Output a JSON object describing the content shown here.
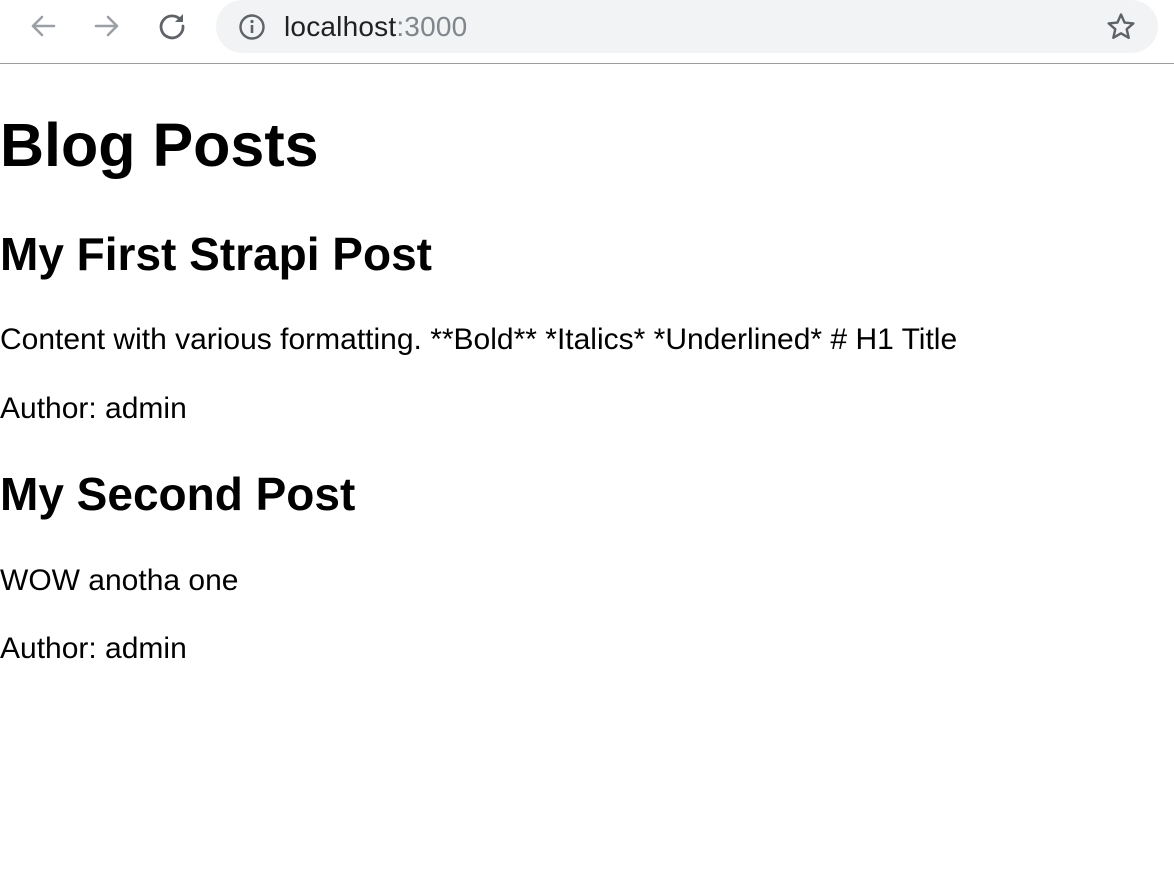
{
  "browser": {
    "url_host": "localhost",
    "url_port": ":3000",
    "icons": {
      "back": "arrow-left-icon",
      "forward": "arrow-right-icon",
      "reload": "reload-icon",
      "info": "info-icon",
      "bookmark": "star-icon"
    }
  },
  "page": {
    "title": "Blog Posts",
    "posts": [
      {
        "title": "My First Strapi Post",
        "content": "Content with various formatting. **Bold** *Italics* *Underlined* # H1 Title",
        "author": "Author: admin"
      },
      {
        "title": "My Second Post",
        "content": "WOW anotha one",
        "author": "Author: admin"
      }
    ]
  },
  "colors": {
    "omnibox_bg": "#f1f3f4",
    "icon_disabled": "#9aa0a6",
    "icon_active": "#5f6368",
    "url_port": "#80868b",
    "toolbar_border": "#9c9c9c"
  }
}
